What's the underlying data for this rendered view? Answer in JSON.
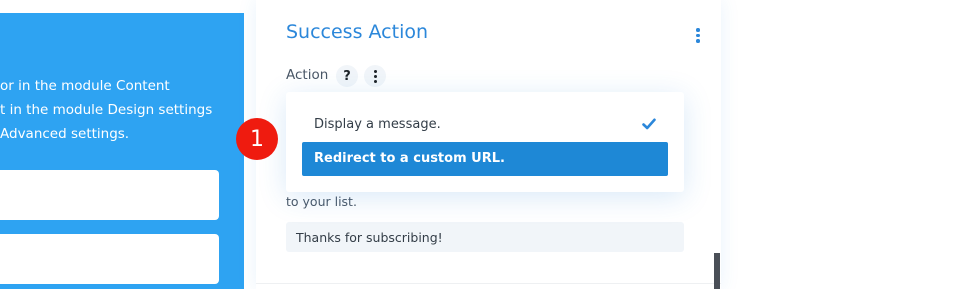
{
  "preview": {
    "lines": [
      "or in the module Content",
      "t in the module Design settings",
      "Advanced settings."
    ]
  },
  "panel": {
    "title": "Success Action",
    "action_label": "Action",
    "help_glyph": "?",
    "hint_text": "to your list.",
    "message_value": "Thanks for subscribing!"
  },
  "dropdown": {
    "options": [
      "Display a message.",
      "Redirect to a custom URL."
    ],
    "checked_index": 0,
    "highlighted_index": 1
  },
  "badge": {
    "number": "1"
  },
  "colors": {
    "preview_bg": "#2ea3f2",
    "accent": "#2b87da",
    "highlight": "#1e88d6",
    "badge": "#ef1b0f"
  },
  "icons": [
    "kebab-menu-icon",
    "help-icon",
    "more-options-icon",
    "checkmark-icon"
  ]
}
